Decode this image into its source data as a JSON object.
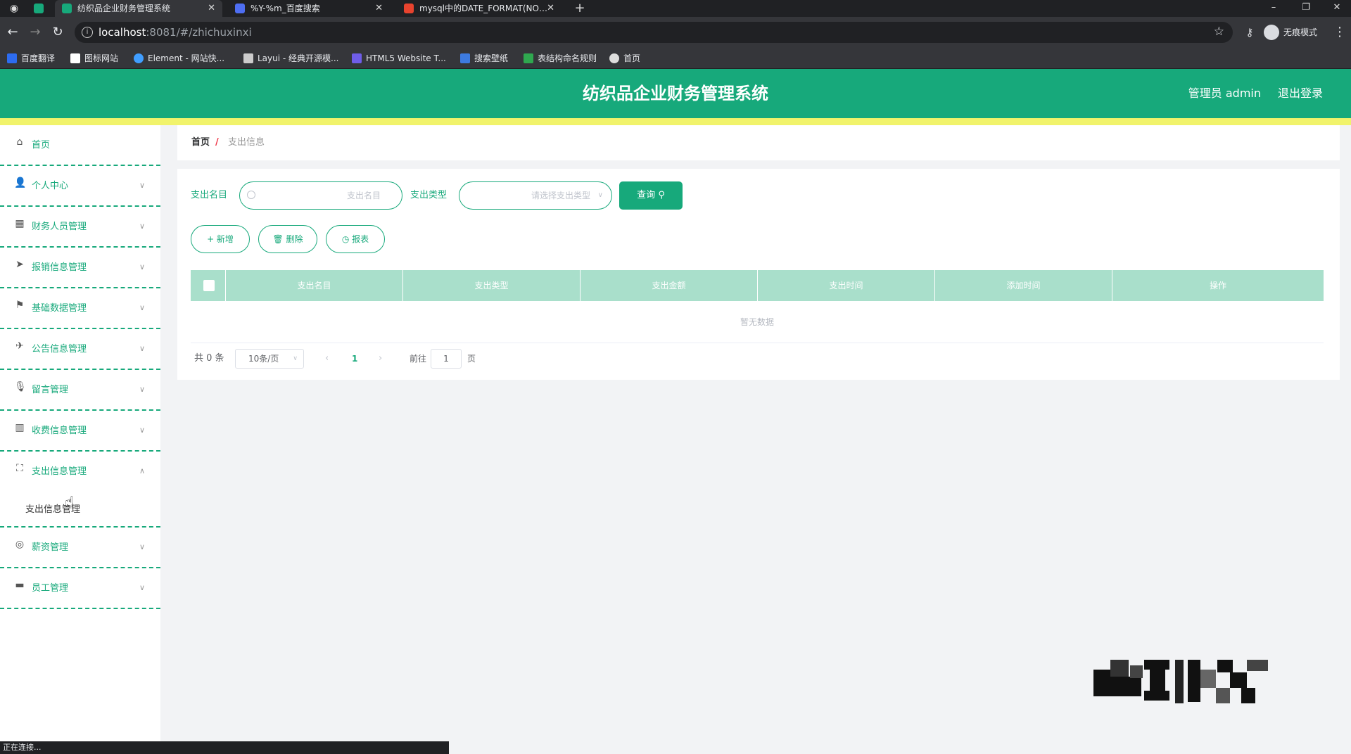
{
  "browser": {
    "tabs": [
      {
        "title": "纺织品企业财务管理系统",
        "active": true,
        "favicon_color": "#17a97b"
      },
      {
        "title": "%Y-%m_百度搜索",
        "active": false,
        "favicon_color": "#4e6ef2"
      },
      {
        "title": "mysql中的DATE_FORMAT(NO…",
        "active": false,
        "favicon_color": "#e8432e"
      }
    ],
    "url_host": "localhost",
    "url_rest": ":8081/#/zhichuxinxi",
    "incognito_label": "无痕模式",
    "bookmarks": [
      {
        "label": "百度翻译",
        "color": "#2d6cf0"
      },
      {
        "label": "图标网站",
        "color": "#ffffff"
      },
      {
        "label": "Element - 网站快...",
        "color": "#409eff"
      },
      {
        "label": "Layui - 经典开源模...",
        "color": "#cccccc"
      },
      {
        "label": "HTML5 Website T...",
        "color": "#6f5de8"
      },
      {
        "label": "搜索壁纸",
        "color": "#3d7be0"
      },
      {
        "label": "表结构命名规则",
        "color": "#2fa84f"
      },
      {
        "label": "首页",
        "color": "#dddddd"
      }
    ],
    "status_text": "正在连接..."
  },
  "header": {
    "title": "纺织品企业财务管理系统",
    "admin_label": "管理员 admin",
    "logout_label": "退出登录",
    "brand_color": "#17a97b",
    "band_color": "#f1f36b"
  },
  "sidebar": {
    "items": [
      {
        "label": "首页",
        "icon": "home-icon",
        "expanded": null
      },
      {
        "label": "个人中心",
        "icon": "user-icon",
        "expanded": false
      },
      {
        "label": "财务人员管理",
        "icon": "grid-icon",
        "expanded": false
      },
      {
        "label": "报销信息管理",
        "icon": "send-icon",
        "expanded": false
      },
      {
        "label": "基础数据管理",
        "icon": "flag-icon",
        "expanded": false
      },
      {
        "label": "公告信息管理",
        "icon": "paper-plane-icon",
        "expanded": false
      },
      {
        "label": "留言管理",
        "icon": "microphone-icon",
        "expanded": false
      },
      {
        "label": "收费信息管理",
        "icon": "chart-icon",
        "expanded": false
      },
      {
        "label": "支出信息管理",
        "icon": "fullscreen-icon",
        "expanded": true,
        "sub": "支出信息管理"
      },
      {
        "label": "薪资管理",
        "icon": "coin-icon",
        "expanded": false
      },
      {
        "label": "员工管理",
        "icon": "monitor-icon",
        "expanded": false
      }
    ]
  },
  "breadcrumb": {
    "home": "首页",
    "separator": "/",
    "current": "支出信息"
  },
  "search": {
    "name_label": "支出名目",
    "name_placeholder": "支出名目",
    "type_label": "支出类型",
    "type_placeholder": "请选择支出类型",
    "query_label": "查询"
  },
  "actions": {
    "add": "+ 新增",
    "delete": "删除",
    "report": "报表"
  },
  "table": {
    "columns": [
      "支出名目",
      "支出类型",
      "支出金额",
      "支出时间",
      "添加时间",
      "操作"
    ],
    "empty_text": "暂无数据"
  },
  "pagination": {
    "total_text": "共 0 条",
    "page_size": "10条/页",
    "prev": "‹",
    "current_page": "1",
    "next": "›",
    "goto_label": "前往",
    "goto_value": "1",
    "page_unit": "页"
  }
}
